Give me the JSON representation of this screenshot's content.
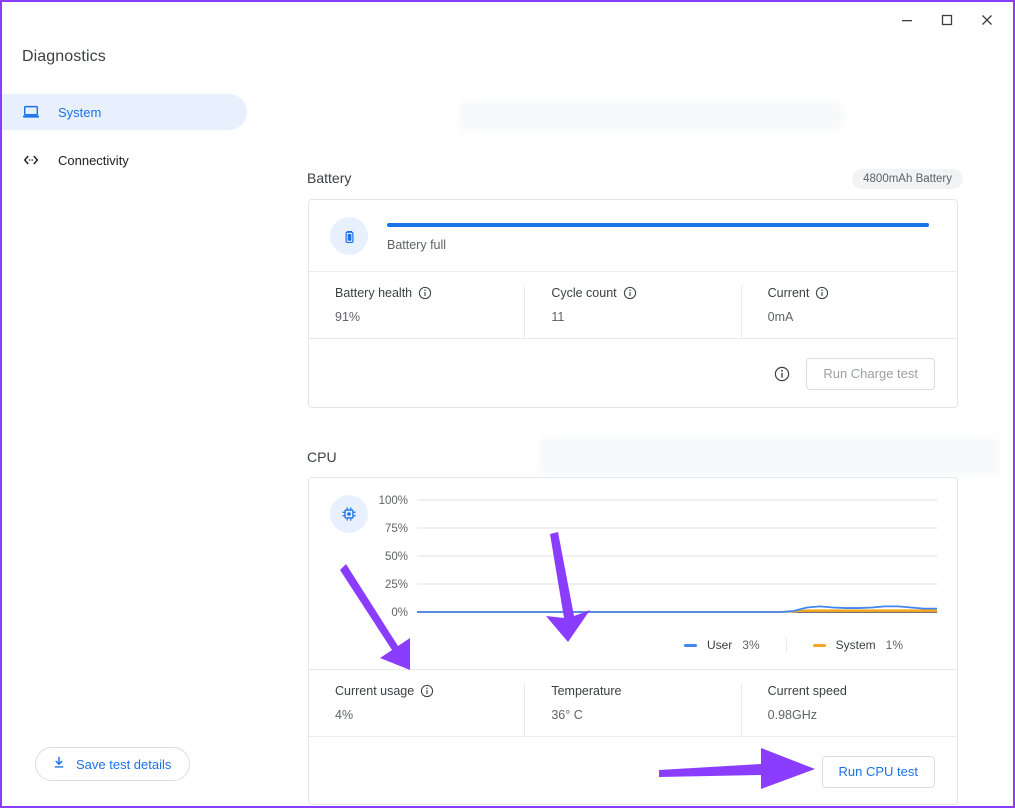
{
  "window": {
    "minimize_label": "Minimize",
    "maximize_label": "Maximize",
    "close_label": "Close"
  },
  "app": {
    "title": "Diagnostics"
  },
  "sidebar": {
    "items": [
      {
        "label": "System",
        "icon": "laptop-icon",
        "active": true
      },
      {
        "label": "Connectivity",
        "icon": "connectivity-icon",
        "active": false
      }
    ],
    "save_button": {
      "label": "Save test details",
      "icon": "download-icon"
    }
  },
  "battery": {
    "section_title": "Battery",
    "badge": "4800mAh Battery",
    "icon": "battery-icon",
    "status": "Battery full",
    "charge_percent": 100,
    "stats": [
      {
        "label": "Battery health",
        "value": "91%",
        "info": true
      },
      {
        "label": "Cycle count",
        "value": "11",
        "info": true
      },
      {
        "label": "Current",
        "value": "0mA",
        "info": true
      }
    ],
    "action": {
      "info_icon": "info-icon",
      "button_label": "Run Charge test",
      "disabled": true
    }
  },
  "cpu": {
    "section_title": "CPU",
    "icon": "cpu-chip-icon",
    "stats": [
      {
        "label": "Current usage",
        "value": "4%",
        "info": true
      },
      {
        "label": "Temperature",
        "value": "36° C",
        "info": false
      },
      {
        "label": "Current speed",
        "value": "0.98GHz",
        "info": false
      }
    ],
    "action": {
      "button_label": "Run CPU test",
      "disabled": false
    }
  },
  "colors": {
    "accent_blue": "#1a73e8",
    "user_line": "#4285f4",
    "system_line": "#f5a623",
    "annotation_purple": "#8b3dff",
    "badge_bg": "#f1f3f4"
  },
  "chart_data": {
    "type": "line",
    "title": "",
    "xlabel": "",
    "ylabel": "",
    "ylim": [
      0,
      100
    ],
    "yticks": [
      0,
      25,
      50,
      75,
      100
    ],
    "ytick_labels": [
      "0%",
      "25%",
      "50%",
      "75%",
      "100%"
    ],
    "grid": true,
    "legend_position": "bottom-right",
    "x": [
      0,
      1,
      2,
      3,
      4,
      5,
      6,
      7,
      8,
      9,
      10,
      11,
      12,
      13,
      14,
      15,
      16,
      17,
      18,
      19,
      20,
      21,
      22,
      23,
      24,
      25,
      26,
      27,
      28,
      29,
      30,
      31,
      32,
      33,
      34,
      35,
      36,
      37,
      38,
      39,
      40
    ],
    "series": [
      {
        "name": "User",
        "color": "#4285f4",
        "current": "3%",
        "values": [
          0,
          0,
          0,
          0,
          0,
          0,
          0,
          0,
          0,
          0,
          0,
          0,
          0,
          0,
          0,
          0,
          0,
          0,
          0,
          0,
          0,
          0,
          0,
          0,
          0,
          0,
          0,
          0,
          0,
          1,
          4,
          5,
          4,
          3.5,
          3.5,
          4,
          5,
          5,
          4,
          3,
          3
        ]
      },
      {
        "name": "System",
        "color": "#f5a623",
        "current": "1%",
        "values": [
          0,
          0,
          0,
          0,
          0,
          0,
          0,
          0,
          0,
          0,
          0,
          0,
          0,
          0,
          0,
          0,
          0,
          0,
          0,
          0,
          0,
          0,
          0,
          0,
          0,
          0,
          0,
          0,
          0,
          0.5,
          1.5,
          1.5,
          1.5,
          1.5,
          1.5,
          1.5,
          1.5,
          1.5,
          1.5,
          1.5,
          1.5
        ]
      }
    ]
  }
}
